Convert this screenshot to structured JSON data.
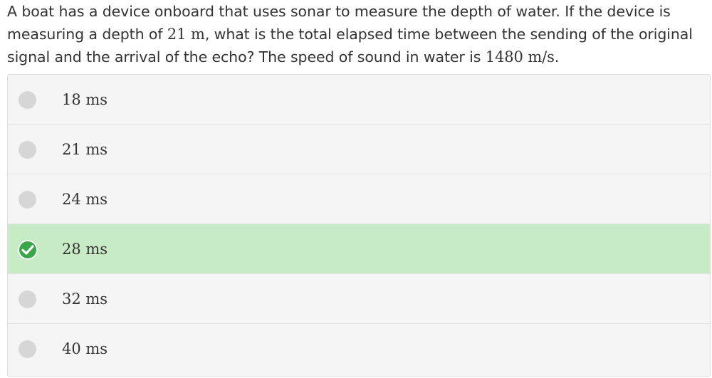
{
  "question": {
    "text_part1": "A boat has a device onboard that uses sonar to measure the depth of water. If the device is measuring a depth of ",
    "depth_value": "21 m",
    "text_part2": ", what is the total elapsed time between the sending of the original signal and the arrival of the echo? The speed of sound in water is ",
    "speed_value": "1480 m/s",
    "text_part3": "."
  },
  "choices": [
    {
      "label": "18 ms",
      "selected": false
    },
    {
      "label": "21 ms",
      "selected": false
    },
    {
      "label": "24 ms",
      "selected": false
    },
    {
      "label": "28 ms",
      "selected": true
    },
    {
      "label": "32 ms",
      "selected": false
    },
    {
      "label": "40 ms",
      "selected": false
    }
  ],
  "colors": {
    "selected_bg": "#c6ebc5",
    "check_green": "#3aa64a",
    "unselected_radio": "#d6d6d6",
    "row_bg": "#f5f5f5"
  },
  "icons": {
    "selected": "check-circle-icon",
    "unselected": "radio-circle-icon"
  }
}
